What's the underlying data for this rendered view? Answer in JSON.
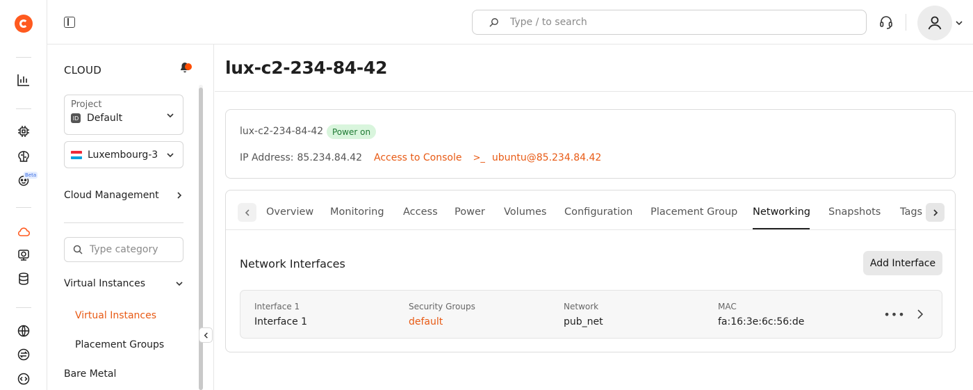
{
  "topbar": {
    "search_placeholder": "Type / to search"
  },
  "rail": {
    "beta_label": "Beta"
  },
  "sidebar": {
    "title": "CLOUD",
    "project": {
      "label": "Project",
      "badge": "ID",
      "value": "Default"
    },
    "region": {
      "value": "Luxembourg-3"
    },
    "cloud_management": "Cloud Management",
    "category_placeholder": "Type category",
    "virtual_instances_group": "Virtual Instances",
    "items": [
      {
        "label": "Virtual Instances",
        "active": true
      },
      {
        "label": "Placement Groups",
        "active": false
      }
    ],
    "bare_metal": "Bare Metal"
  },
  "main": {
    "title": "lux-c2-234-84-42",
    "summary": {
      "name": "lux-c2-234-84-42",
      "status": "Power on",
      "ip_label": "IP Address:",
      "ip_value": "85.234.84.42",
      "console_link": "Access to Console",
      "ssh_prompt": ">_",
      "ssh_link": "ubuntu@85.234.84.42"
    },
    "tabs": [
      {
        "label": "Overview"
      },
      {
        "label": "Monitoring"
      },
      {
        "label": "Access"
      },
      {
        "label": "Power"
      },
      {
        "label": "Volumes"
      },
      {
        "label": "Configuration"
      },
      {
        "label": "Placement Group"
      },
      {
        "label": "Networking",
        "active": true
      },
      {
        "label": "Snapshots"
      },
      {
        "label": "Tags"
      }
    ],
    "networking": {
      "section_title": "Network Interfaces",
      "add_button": "Add Interface",
      "interfaces": [
        {
          "interface_label": "Interface 1",
          "interface_value": "Interface 1",
          "security_label": "Security Groups",
          "security_value": "default",
          "network_label": "Network",
          "network_value": "pub_net",
          "mac_label": "MAC",
          "mac_value": "fa:16:3e:6c:56:de",
          "more": "•••"
        }
      ]
    }
  },
  "colors": {
    "accent": "#e85a14",
    "brand": "#ff5a1f",
    "power_on_bg": "#d9f5dd",
    "power_on_text": "#1f7a34"
  }
}
